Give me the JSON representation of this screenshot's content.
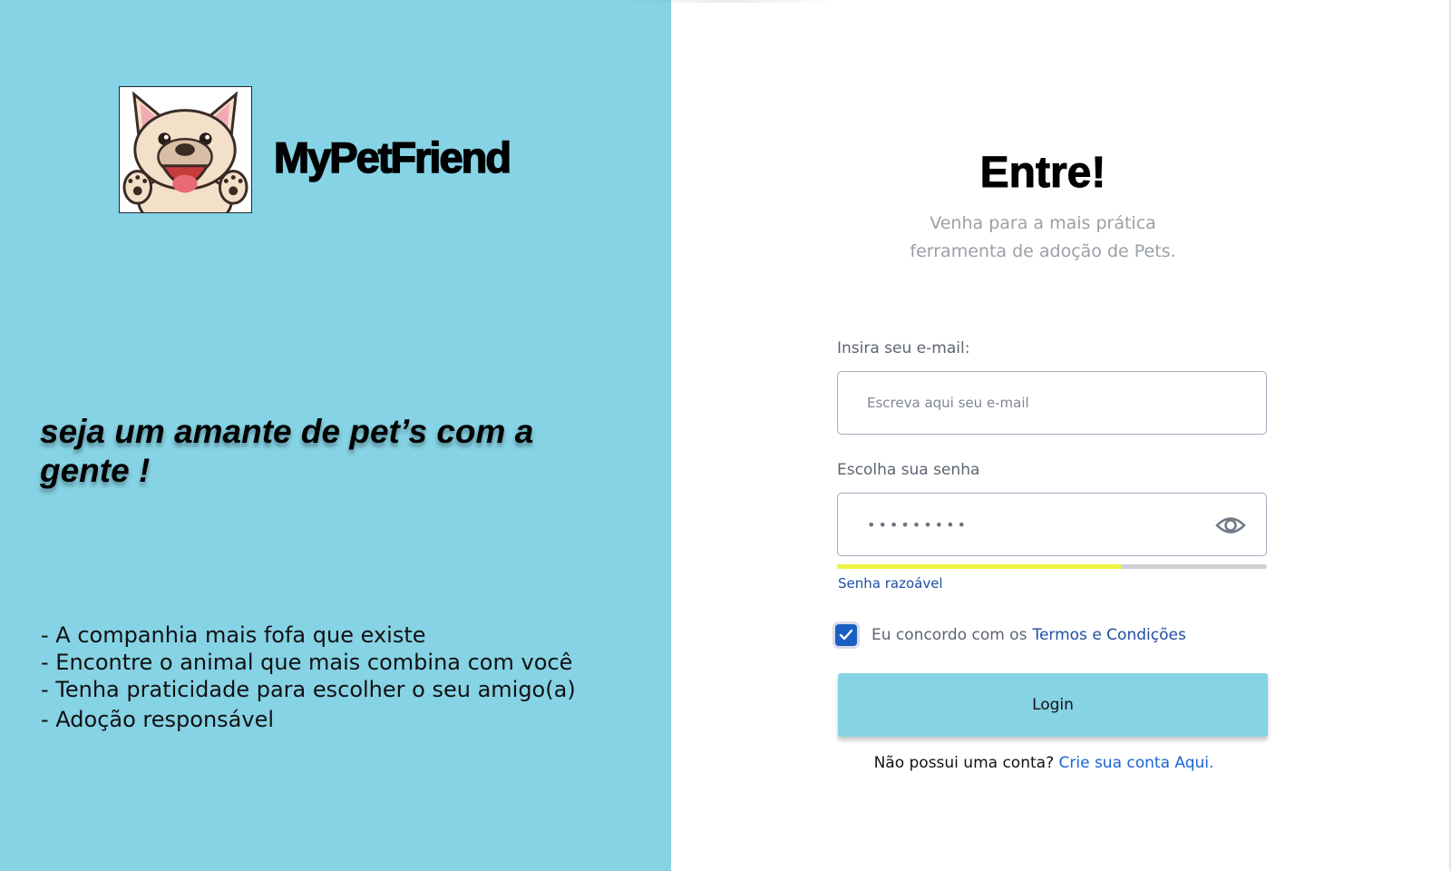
{
  "brand": {
    "name": "MyPetFriend",
    "logo_icon": "french-bulldog-mascot-icon"
  },
  "left": {
    "tagline": "seja um amante de pet’s com a gente !",
    "features": [
      "- A companhia mais fofa que existe",
      "- Encontre o animal que mais combina com você",
      "- Tenha praticidade para escolher o seu amigo(a)",
      "- Adoção responsável"
    ]
  },
  "form": {
    "heading": "Entre!",
    "subtitle_line1": "Venha para a mais prática",
    "subtitle_line2": "ferramenta de adoção de Pets.",
    "email_label": "Insira seu e-mail:",
    "email_placeholder": "Escreva aqui seu e-mail",
    "email_value": "",
    "password_label": "Escolha sua senha",
    "password_masked": "•••••••••",
    "password_toggle_icon": "eye-icon",
    "strength": {
      "label": "Senha razoável",
      "level": 0.66,
      "fill_color": "#eef545"
    },
    "terms_checked": true,
    "terms_prefix": "Eu concordo com os",
    "terms_link": "Termos e Condições",
    "login_label": "Login",
    "signup_prefix": "Não possui uma conta?",
    "signup_link": "Crie sua conta Aqui."
  },
  "colors": {
    "accent": "#86d3e5",
    "link": "#1f4ea3",
    "checkbox": "#1b5fc4"
  }
}
